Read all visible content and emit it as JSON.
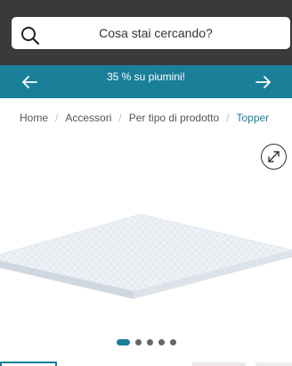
{
  "search": {
    "placeholder": "Cosa stai cercando?"
  },
  "promo": {
    "text": "35 % su piumini!"
  },
  "breadcrumb": {
    "items": [
      "Home",
      "Accessori",
      "Per tipo di prodotto",
      "Topper"
    ]
  },
  "carousel": {
    "slide_count": 5,
    "active_index": 0
  },
  "colors": {
    "header_bg": "#3a3a3a",
    "accent": "#1a7f99",
    "promo_text": "#ffffff"
  },
  "icons": {
    "search": "search-icon",
    "prev": "arrow-left-icon",
    "next": "arrow-right-icon",
    "zoom": "expand-icon"
  }
}
